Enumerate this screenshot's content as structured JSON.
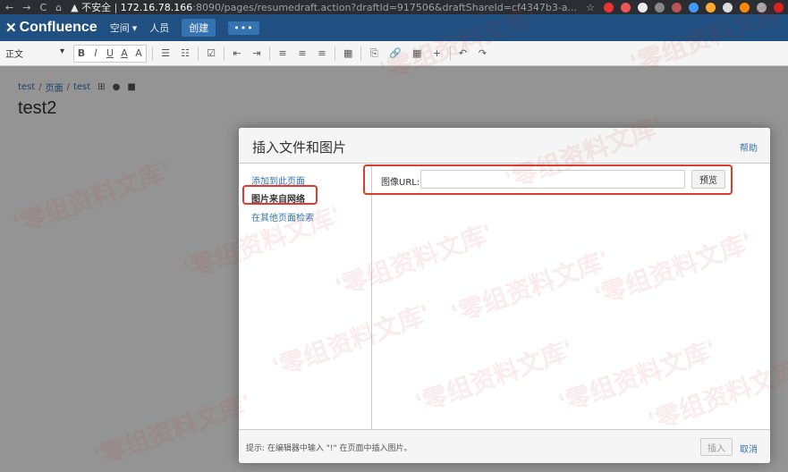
{
  "browser": {
    "nav_buttons": [
      "←",
      "→",
      "C",
      "⌂"
    ],
    "security_label": "▲ 不安全",
    "url_host": "172.16.78.166",
    "url_rest": ":8090/pages/resumedraft.action?draftId=917506&draftShareId=cf4347b3-a...",
    "star_icon": "☆"
  },
  "header": {
    "logo_mark": "✕",
    "logo_text": "Confluence",
    "spaces_label": "空间",
    "people_label": "人员",
    "create_label": "创建",
    "more_label": "•••"
  },
  "toolbar": {
    "paragraph_style": "正文",
    "buttons": [
      "B",
      "I",
      "U",
      "A",
      "A",
      "☰",
      "☷",
      "☑",
      "⇤",
      "⇥",
      "≡",
      "≡",
      "≡",
      "▦",
      "⎘",
      "🔗",
      "▦",
      "+",
      "↶",
      "↷"
    ]
  },
  "page": {
    "breadcrumb": [
      "test",
      "页面",
      "test"
    ],
    "breadcrumb_sep": "/",
    "title": "test2"
  },
  "dialog": {
    "title": "插入文件和图片",
    "help_label": "帮助",
    "nav_items": [
      "添加到此页面",
      "图片来自网络",
      "在其他页面检索"
    ],
    "active_nav_index": 1,
    "url_label": "图像URL:",
    "url_value": "",
    "preview_label": "预览",
    "hint": "提示: 在编辑器中输入 \"!\" 在页面中插入图片。",
    "insert_label": "插入",
    "cancel_label": "取消"
  },
  "watermark": "'零组资料文库'",
  "colors": {
    "header_bg": "#205081",
    "link": "#3572b0",
    "annotation": "#e0392d"
  }
}
